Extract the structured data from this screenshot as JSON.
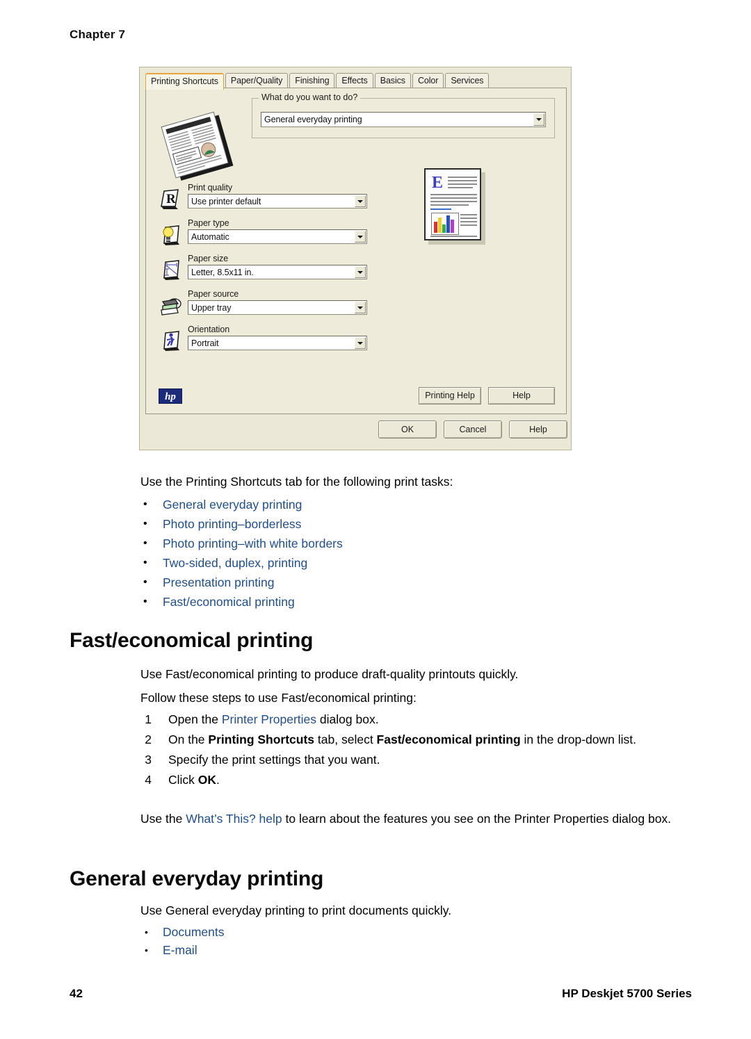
{
  "page": {
    "chapter_label": "Chapter 7",
    "page_number": "42",
    "footer_series": "HP Deskjet 5700 Series"
  },
  "dialog": {
    "name": "printer-properties-dialog",
    "tabs": [
      {
        "label": "Printing Shortcuts",
        "active": true
      },
      {
        "label": "Paper/Quality",
        "active": false
      },
      {
        "label": "Finishing",
        "active": false
      },
      {
        "label": "Effects",
        "active": false
      },
      {
        "label": "Basics",
        "active": false
      },
      {
        "label": "Color",
        "active": false
      },
      {
        "label": "Services",
        "active": false
      }
    ],
    "group": {
      "title": "What do you want to do?",
      "selected": "General everyday printing"
    },
    "settings": [
      {
        "icon": "print-quality-icon",
        "label": "Print quality",
        "value": "Use printer default"
      },
      {
        "icon": "paper-type-icon",
        "label": "Paper type",
        "value": "Automatic"
      },
      {
        "icon": "paper-size-icon",
        "label": "Paper size",
        "value": "Letter, 8.5x11 in."
      },
      {
        "icon": "paper-source-icon",
        "label": "Paper source",
        "value": "Upper tray"
      },
      {
        "icon": "orientation-icon",
        "label": "Orientation",
        "value": "Portrait"
      }
    ],
    "logo_text": "hp",
    "buttons": {
      "printing_help": "Printing Help",
      "panel_help": "Help",
      "ok": "OK",
      "cancel": "Cancel",
      "help": "Help"
    },
    "preview_dropcap": "E",
    "colors": {
      "dialog_bg": "#ece9d8",
      "panel_bg": "#eeebda",
      "active_tab_accent": "#e7a53c",
      "hp_logo_bg": "#1b2a7a"
    }
  },
  "content": {
    "intro": "Use the Printing Shortcuts tab for the following print tasks:",
    "shortcut_links": [
      "General everyday printing",
      "Photo printing–borderless",
      "Photo printing–with white borders",
      "Two-sided, duplex, printing",
      "Presentation printing",
      "Fast/economical printing"
    ],
    "fast_section": {
      "heading": "Fast/economical printing",
      "para_1": "Use Fast/economical printing to produce draft-quality printouts quickly.",
      "para_2": "Follow these steps to use Fast/economical printing:",
      "steps": [
        {
          "num": "1",
          "parts": [
            {
              "text": "Open the ",
              "style": "plain"
            },
            {
              "text": "Printer Properties",
              "style": "link"
            },
            {
              "text": " dialog box.",
              "style": "plain"
            }
          ]
        },
        {
          "num": "2",
          "parts": [
            {
              "text": "On the ",
              "style": "plain"
            },
            {
              "text": "Printing Shortcuts",
              "style": "bold"
            },
            {
              "text": " tab, select ",
              "style": "plain"
            },
            {
              "text": "Fast/economical printing",
              "style": "bold"
            },
            {
              "text": " in the drop-down list.",
              "style": "plain"
            }
          ]
        },
        {
          "num": "3",
          "parts": [
            {
              "text": "Specify the print settings that you want.",
              "style": "plain"
            }
          ]
        },
        {
          "num": "4",
          "parts": [
            {
              "text": "Click ",
              "style": "plain"
            },
            {
              "text": "OK",
              "style": "bold"
            },
            {
              "text": ".",
              "style": "plain"
            }
          ]
        }
      ],
      "whats_this": {
        "before": "Use the ",
        "link": "What’s This? help",
        "after": " to learn about the features you see on the Printer Properties dialog box."
      }
    },
    "general_section": {
      "heading": "General everyday printing",
      "para_1": "Use General everyday printing to print documents quickly.",
      "links": [
        "Documents",
        "E-mail"
      ]
    }
  }
}
